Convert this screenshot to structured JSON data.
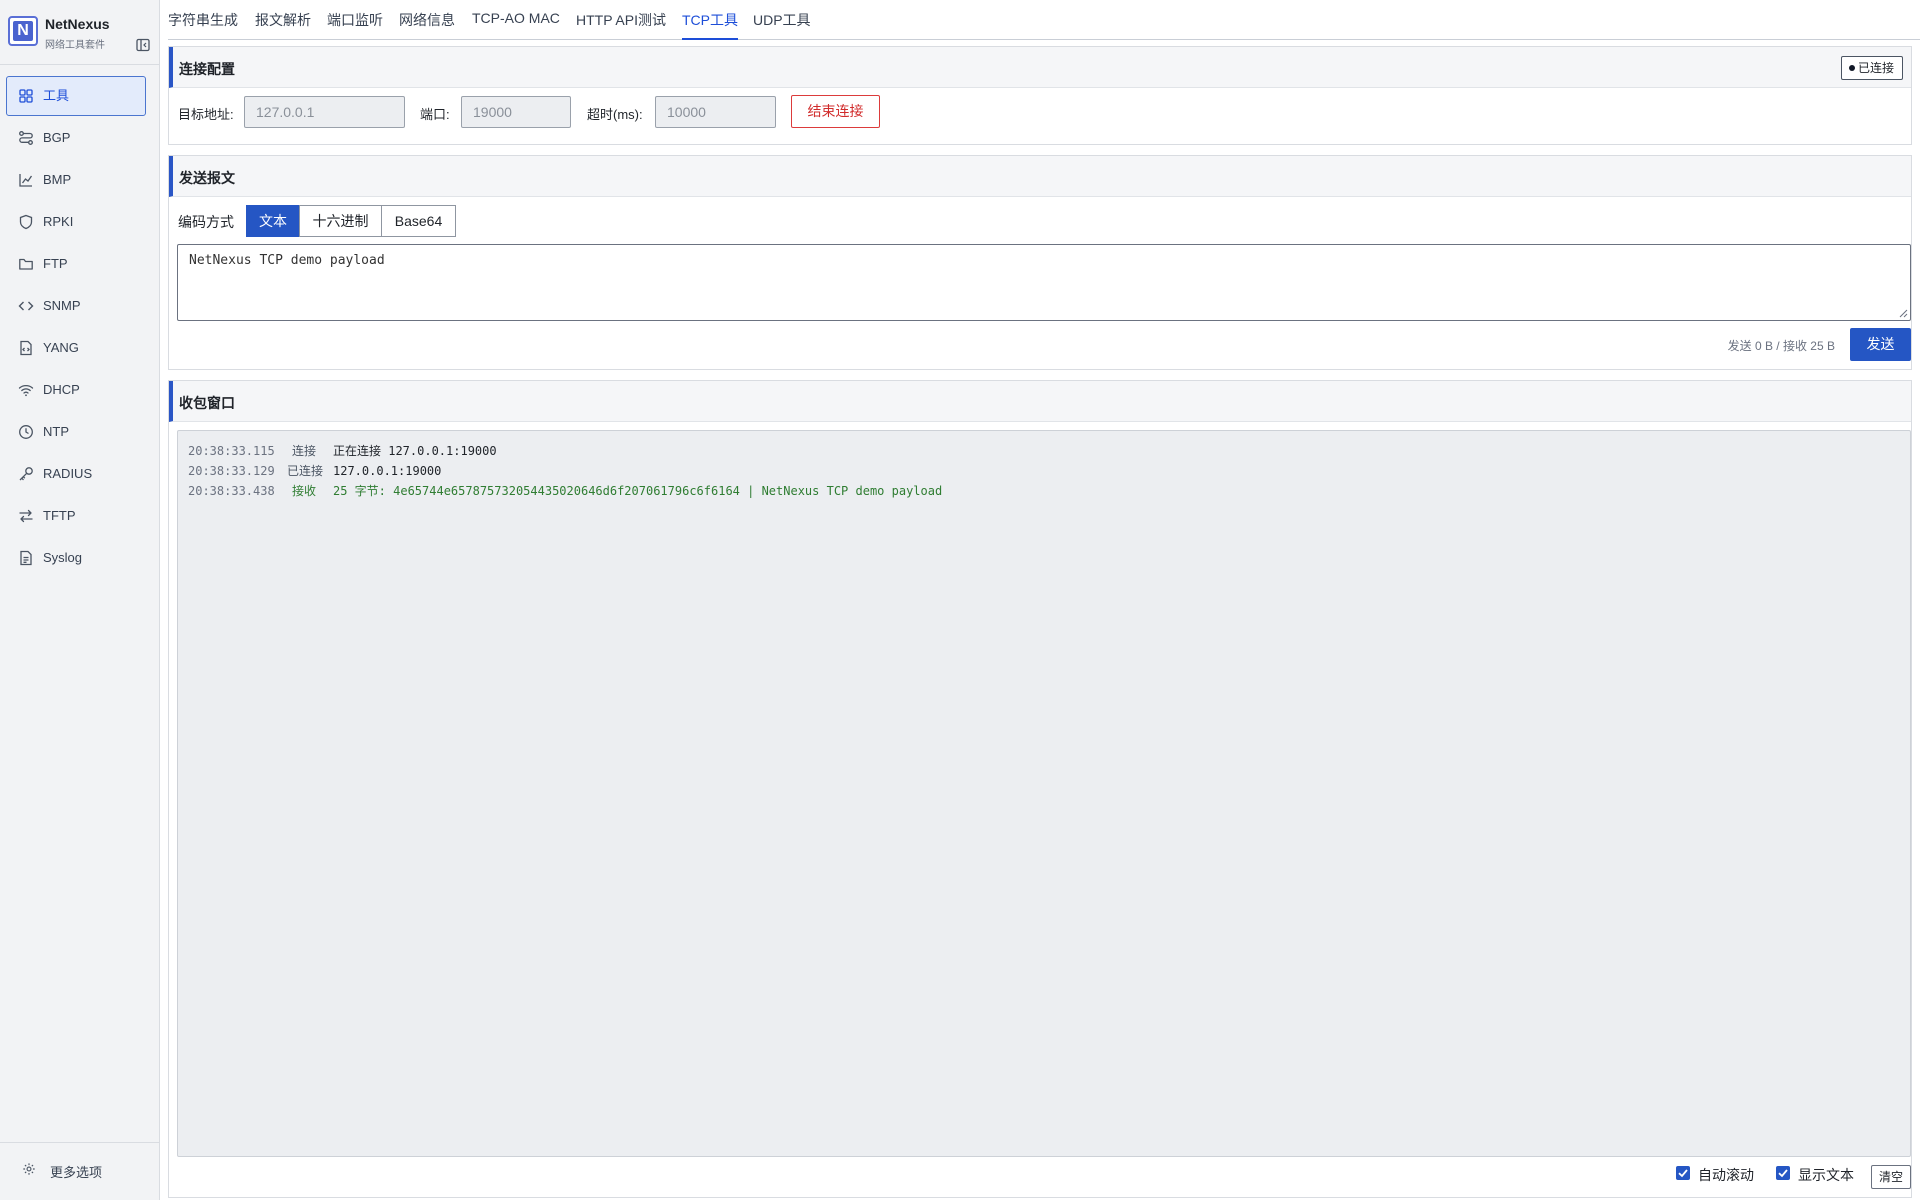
{
  "app": {
    "name": "NetNexus",
    "subtitle": "网络工具套件"
  },
  "sidebar": {
    "items": [
      {
        "label": "工具",
        "icon": "grid-icon",
        "active": true
      },
      {
        "label": "BGP",
        "icon": "route-icon"
      },
      {
        "label": "BMP",
        "icon": "chart-icon"
      },
      {
        "label": "RPKI",
        "icon": "shield-icon"
      },
      {
        "label": "FTP",
        "icon": "folder-icon"
      },
      {
        "label": "SNMP",
        "icon": "code-icon"
      },
      {
        "label": "YANG",
        "icon": "file-code-icon"
      },
      {
        "label": "DHCP",
        "icon": "wifi-icon"
      },
      {
        "label": "NTP",
        "icon": "clock-icon"
      },
      {
        "label": "RADIUS",
        "icon": "key-icon"
      },
      {
        "label": "TFTP",
        "icon": "transfer-icon"
      },
      {
        "label": "Syslog",
        "icon": "document-icon"
      }
    ],
    "more_label": "更多选项"
  },
  "tabs": [
    {
      "label": "字符串生成"
    },
    {
      "label": "报文解析"
    },
    {
      "label": "端口监听"
    },
    {
      "label": "网络信息"
    },
    {
      "label": "TCP-AO MAC"
    },
    {
      "label": "HTTP API测试"
    },
    {
      "label": "TCP工具",
      "active": true
    },
    {
      "label": "UDP工具"
    }
  ],
  "connection": {
    "title": "连接配置",
    "status": "已连接",
    "target_label": "目标地址:",
    "target_value": "127.0.0.1",
    "port_label": "端口:",
    "port_value": "19000",
    "timeout_label": "超时(ms):",
    "timeout_value": "10000",
    "disconnect_label": "结束连接"
  },
  "send": {
    "title": "发送报文",
    "encoding_label": "编码方式",
    "encodings": [
      "文本",
      "十六进制",
      "Base64"
    ],
    "selected_encoding": "文本",
    "payload": "NetNexus TCP demo payload",
    "stats": "发送 0 B / 接收 25 B",
    "send_label": "发送"
  },
  "receive": {
    "title": "收包窗口",
    "log": [
      {
        "time": "20:38:33.115",
        "kind": "连接",
        "message": "正在连接 127.0.0.1:19000"
      },
      {
        "time": "20:38:33.129",
        "kind": "已连接",
        "message": "127.0.0.1:19000"
      },
      {
        "time": "20:38:33.438",
        "kind": "接收",
        "message": "25 字节: 4e65744e657875732054435020646d6f207061796c6f6164  |  NetNexus TCP demo payload"
      }
    ],
    "auto_scroll_label": "自动滚动",
    "show_text_label": "显示文本",
    "clear_label": "清空"
  },
  "colors": {
    "accent": "#2556c4",
    "danger": "#d12c2c",
    "received": "#2f7d32"
  }
}
